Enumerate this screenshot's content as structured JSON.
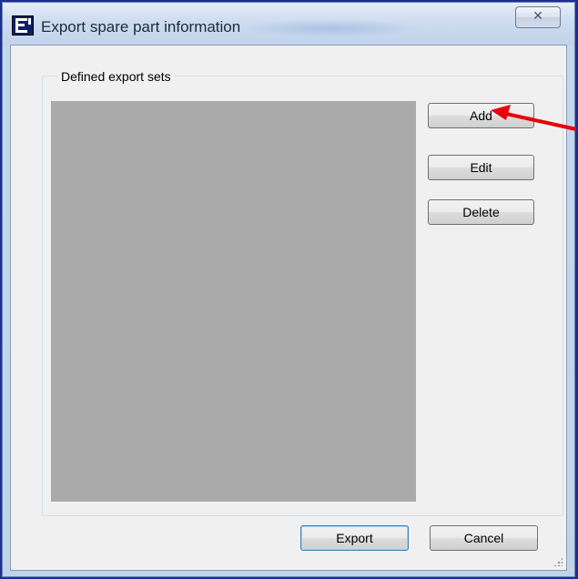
{
  "window": {
    "title": "Export spare part information",
    "close_symbol": "☒"
  },
  "group": {
    "label": "Defined export sets"
  },
  "buttons": {
    "add": "Add",
    "edit": "Edit",
    "delete": "Delete",
    "export": "Export",
    "cancel": "Cancel"
  },
  "annotation": {
    "arrow_color": "#e8000b",
    "points_to": "add-button"
  },
  "colors": {
    "frame": "#1b2e93",
    "listbox_bg": "#aaaaaa",
    "client_bg": "#f0f0f0"
  }
}
